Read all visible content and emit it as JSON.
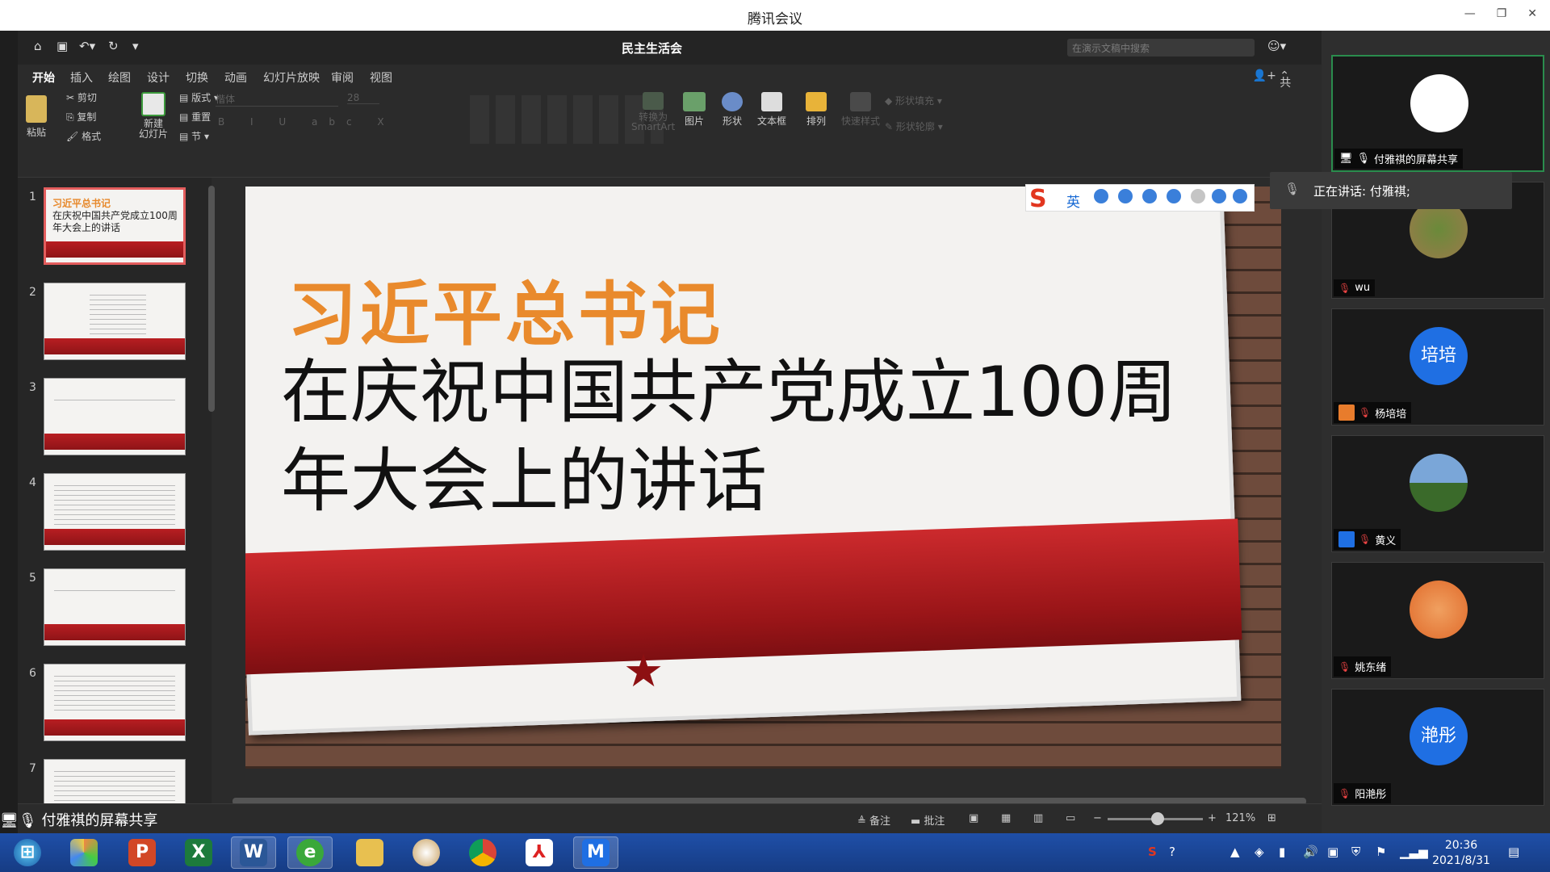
{
  "window": {
    "title": "腾讯会议"
  },
  "ppt": {
    "doc_title": "民主生活会",
    "search_placeholder": "在演示文稿中搜索",
    "tabs": [
      "开始",
      "插入",
      "绘图",
      "设计",
      "切换",
      "动画",
      "幻灯片放映",
      "审阅",
      "视图"
    ],
    "share": "共享",
    "ribbon": {
      "paste": "粘贴",
      "cut": "剪切",
      "copy": "复制",
      "format": "格式",
      "new_slide": "新建\n幻灯片",
      "layout": "版式",
      "reset": "重置",
      "section": "节",
      "font": "楷体",
      "size": "28",
      "smartart": "转换为\nSmartArt",
      "picture": "图片",
      "shape": "形状",
      "textbox": "文本框",
      "arrange": "排列",
      "quick_style": "快速样式",
      "shape_fill": "形状填充",
      "shape_outline": "形状轮廓"
    },
    "thumbs": [
      "1",
      "2",
      "3",
      "4",
      "5",
      "6",
      "7"
    ],
    "thumb1": {
      "orange": "习近平总书记",
      "black": "在庆祝中国共产党成立100周年大会上的讲话"
    },
    "slide": {
      "title": "习近平总书记",
      "subtitle": "在庆祝中国共产党成立100周年大会上的讲话"
    },
    "ime": {
      "lang": "英"
    },
    "status": {
      "notes": "备注",
      "comments": "批注",
      "zoom": "121%"
    }
  },
  "screen_share_label": "付雅祺的屏幕共享",
  "participants": [
    {
      "name": "付雅祺的屏幕共享"
    },
    {
      "name": "wu"
    },
    {
      "name": "杨培培",
      "avatar_text": "培培"
    },
    {
      "name": "黄义"
    },
    {
      "name": "姚东绪"
    },
    {
      "name": "阳滟彤",
      "avatar_text": "滟彤"
    }
  ],
  "speaking": "正在讲话: 付雅祺;",
  "clock": {
    "time": "20:36",
    "date": "2021/8/31"
  },
  "taskbar_icons": [
    "start-icon",
    "pinwheel-icon",
    "powerpoint-icon",
    "excel-icon",
    "word-icon",
    "browser-icon",
    "folder-icon",
    "paint-icon",
    "chrome-icon",
    "pdf-icon",
    "tencent-meeting-icon"
  ]
}
